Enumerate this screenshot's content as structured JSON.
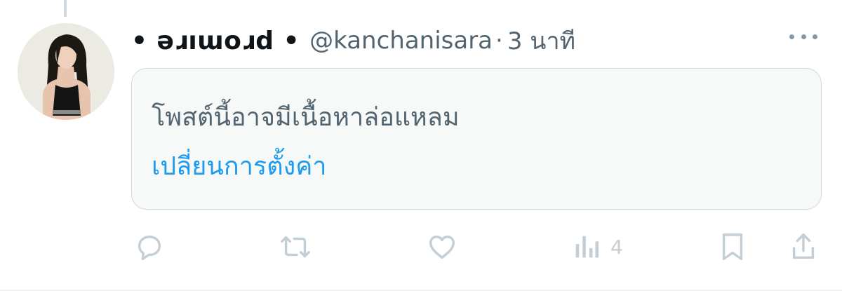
{
  "tweet": {
    "display_name": "• ǝɹıɯoɹd •",
    "handle": "@kanchanisara",
    "separator": "·",
    "time": "3 นาที",
    "warning_text": "โพสต์นี้อาจมีเนื้อหาล่อแหลม",
    "settings_link": "เปลี่ยนการตั้งค่า"
  },
  "actions": {
    "views_count": "4"
  },
  "colors": {
    "accent": "#1d9bf0",
    "secondary_text": "#536471",
    "icon_muted": "#c4ced5",
    "box_background": "#f7f9f9",
    "box_border": "#cfd9de"
  },
  "icons": {
    "reply": "reply-icon",
    "retweet": "retweet-icon",
    "like": "heart-icon",
    "views": "views-icon",
    "bookmark": "bookmark-icon",
    "share": "share-icon",
    "more": "more-icon"
  }
}
